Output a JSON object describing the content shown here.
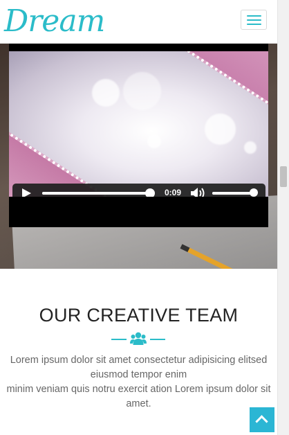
{
  "navbar": {
    "logo_text": "Dream",
    "brand_color": "#2bbcc9"
  },
  "video": {
    "current_time": "0:09",
    "progress_fraction": 0.96,
    "volume_fraction": 0.96
  },
  "team": {
    "title": "OUR CREATIVE TEAM",
    "icon": "users-icon",
    "description_line1": "Lorem ipsum dolor sit amet consectetur adipisicing elitsed eiusmod tempor enim",
    "description_line2": "minim veniam quis notru exercit ation Lorem ipsum dolor sit amet."
  },
  "back_to_top": {
    "icon": "chevron-up-icon",
    "color": "#2bb6d4"
  }
}
